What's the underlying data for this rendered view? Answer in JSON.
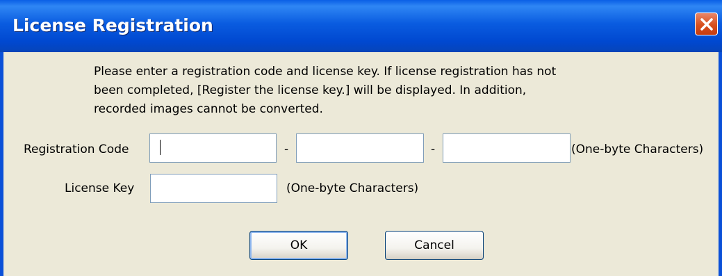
{
  "window": {
    "title": "License Registration"
  },
  "description": "Please enter a registration code and license key. If license registration has not\nbeen completed, [Register the license key.] will be displayed. In addition,\nrecorded images cannot be converted.",
  "registration": {
    "label": "Registration Code",
    "separator": "-",
    "hint": "(One-byte Characters)",
    "values": [
      "",
      "",
      ""
    ]
  },
  "license": {
    "label": "License Key",
    "hint": "(One-byte Characters)",
    "value": ""
  },
  "buttons": {
    "ok": "OK",
    "cancel": "Cancel"
  },
  "icons": {
    "close": "close-icon"
  },
  "colors": {
    "titlebar": "#0a5ce0",
    "close": "#d8501e",
    "dialog": "#ece9d8"
  }
}
